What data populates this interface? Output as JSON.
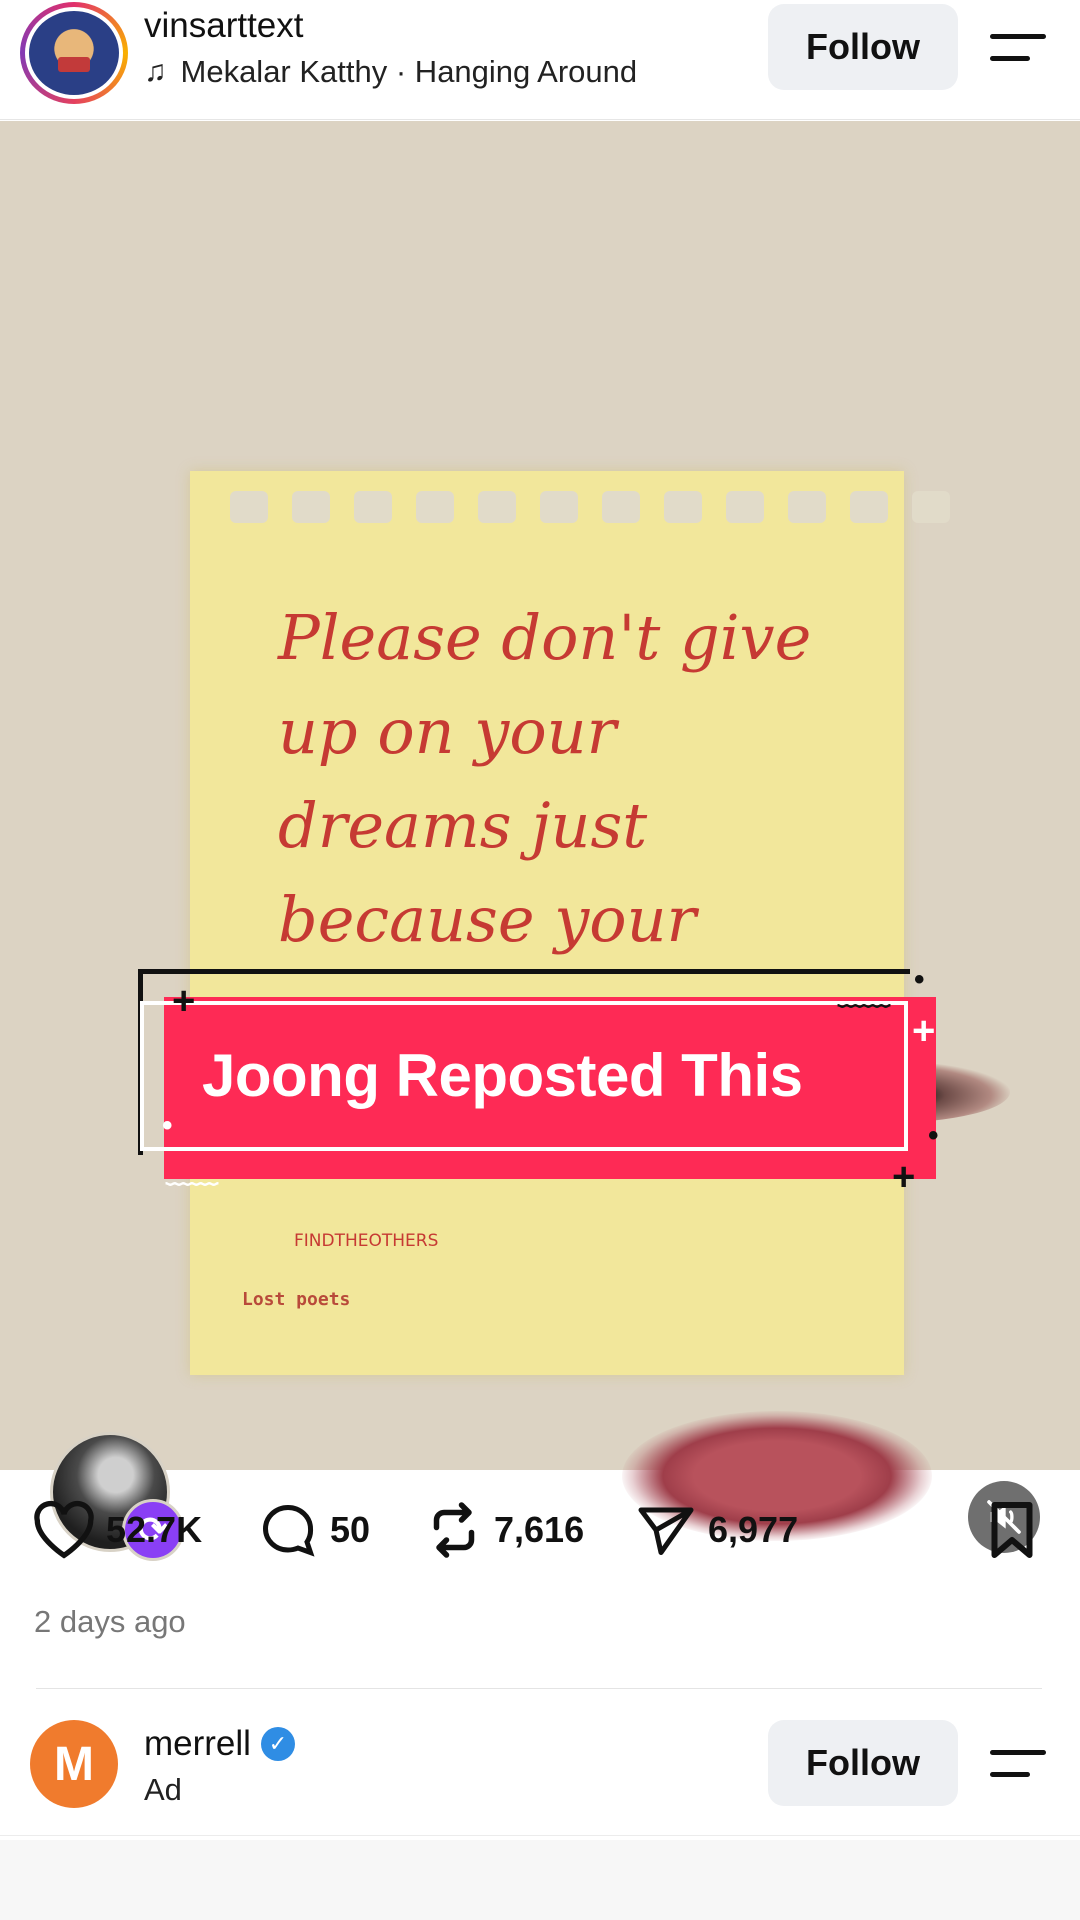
{
  "header": {
    "username": "vinsarttext",
    "music": "Mekalar Katthy · Hanging Around",
    "follow_label": "Follow"
  },
  "post": {
    "note_text": "Please don't give up on your dreams just because your",
    "note_footer_1": "FINDTHEOTHERS",
    "note_footer_2": "Lost poets",
    "banner_text": "Joong Reposted This"
  },
  "actions": {
    "likes": "52.7K",
    "comments": "50",
    "reposts": "7,616",
    "shares": "6,977"
  },
  "timestamp": "2 days ago",
  "next_post": {
    "username": "merrell",
    "avatar_letter": "M",
    "sub_label": "Ad",
    "follow_label": "Follow"
  },
  "colors": {
    "accent": "#fe2a55",
    "repost_badge": "#8a3ff5",
    "verified": "#2f8de4"
  }
}
